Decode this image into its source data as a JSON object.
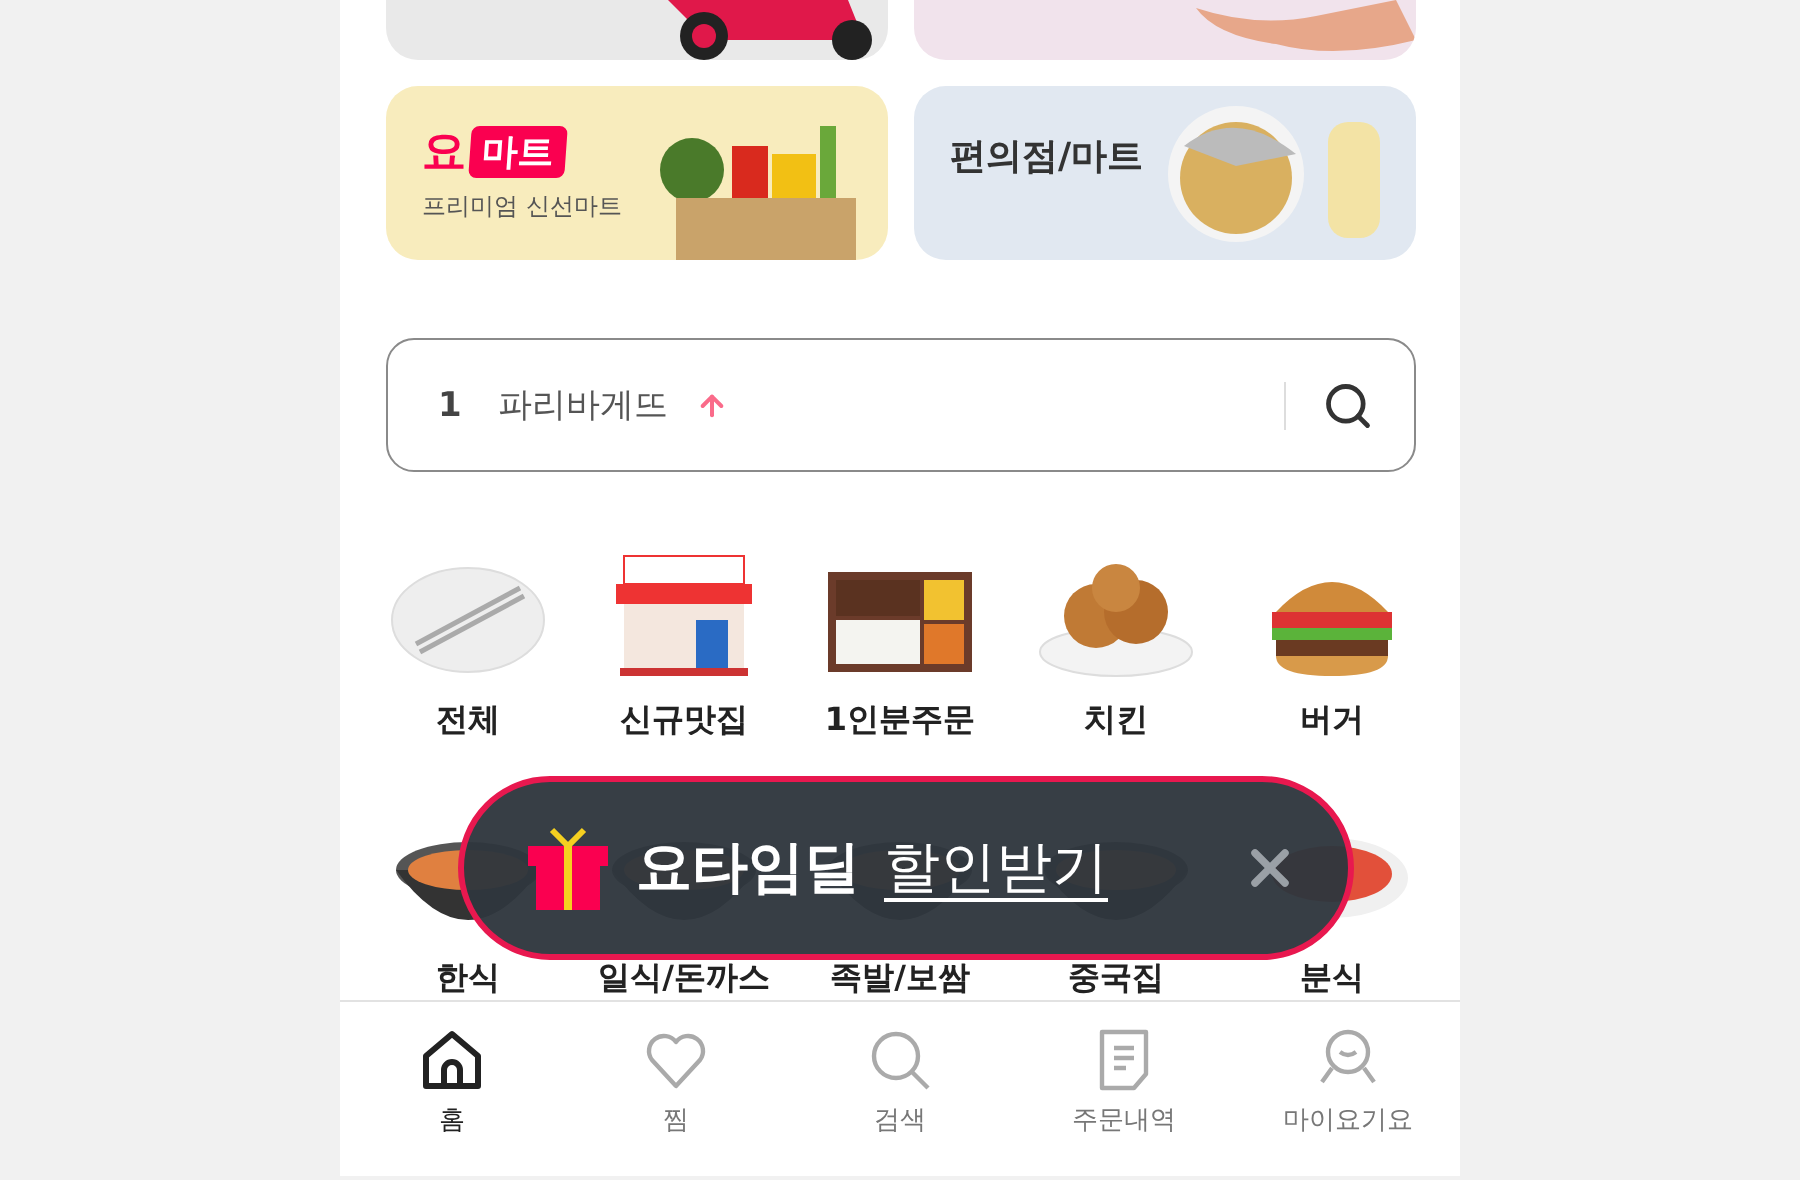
{
  "promo_cards": [
    {
      "kind": "mart",
      "logo_mark": "요",
      "logo_box": "마트",
      "subtitle": "프리미엄 신선마트"
    },
    {
      "kind": "convenience",
      "title": "편의점/마트"
    }
  ],
  "search": {
    "rank": "1",
    "term": "파리바게뜨",
    "rising": true
  },
  "categories": [
    {
      "label": "전체",
      "kind": "plate"
    },
    {
      "label": "신규맛집",
      "kind": "store"
    },
    {
      "label": "1인분주문",
      "kind": "lunchbox"
    },
    {
      "label": "치킨",
      "kind": "chicken"
    },
    {
      "label": "버거",
      "kind": "burger"
    },
    {
      "label": "한식",
      "kind": "bowl"
    },
    {
      "label": "일식/돈까스",
      "kind": "bowl"
    },
    {
      "label": "족발/보쌈",
      "kind": "bowl"
    },
    {
      "label": "중국집",
      "kind": "bowl"
    },
    {
      "label": "분식",
      "kind": "soup"
    }
  ],
  "toast": {
    "title": "요타임딜",
    "link": "할인받기"
  },
  "bottom_nav": [
    {
      "label": "홈",
      "kind": "home",
      "selected": true
    },
    {
      "label": "찜",
      "kind": "heart",
      "selected": false
    },
    {
      "label": "검색",
      "kind": "search",
      "selected": false
    },
    {
      "label": "주문내역",
      "kind": "receipt",
      "selected": false
    },
    {
      "label": "마이요기요",
      "kind": "person",
      "selected": false
    }
  ]
}
